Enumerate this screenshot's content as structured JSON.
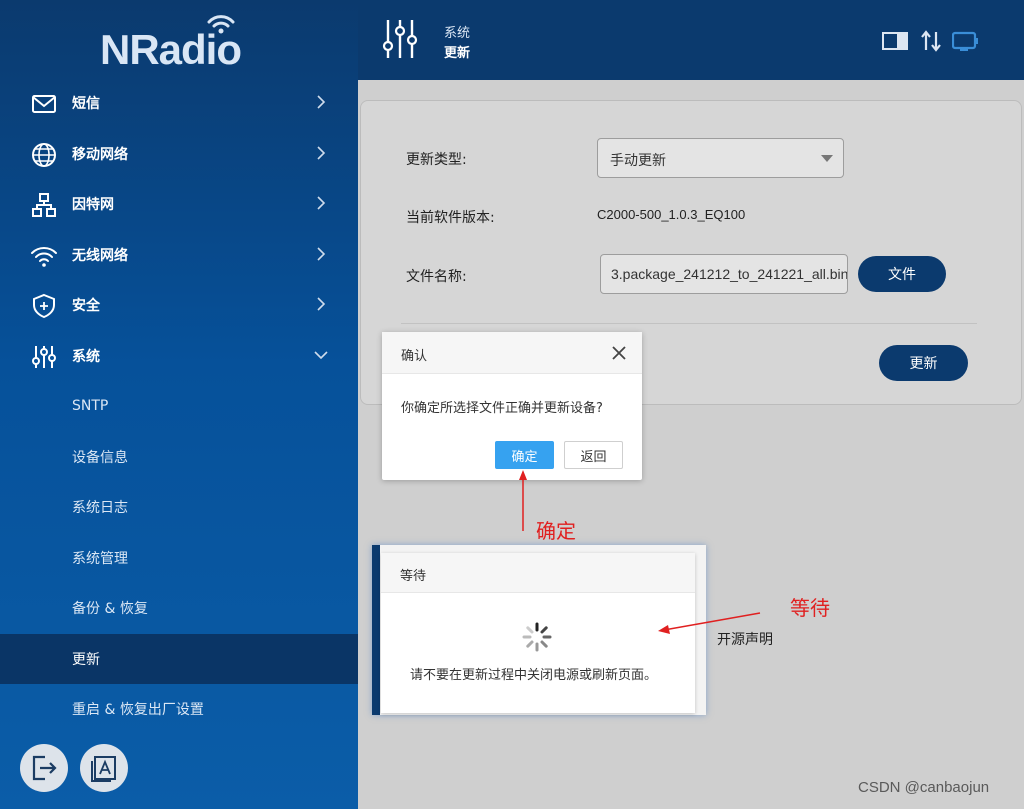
{
  "brand": {
    "logo_text": "NRadio"
  },
  "sidebar": {
    "items": [
      {
        "label": "短信",
        "icon": "mail-icon"
      },
      {
        "label": "移动网络",
        "icon": "globe-icon"
      },
      {
        "label": "因特网",
        "icon": "network-icon"
      },
      {
        "label": "无线网络",
        "icon": "wifi-icon"
      },
      {
        "label": "安全",
        "icon": "shield-icon"
      },
      {
        "label": "系统",
        "icon": "sliders-icon",
        "expanded": true
      }
    ],
    "subitems": [
      {
        "label": "SNTP"
      },
      {
        "label": "设备信息"
      },
      {
        "label": "系统日志"
      },
      {
        "label": "系统管理"
      },
      {
        "label": "备份 & 恢复"
      },
      {
        "label": "更新",
        "active": true
      },
      {
        "label": "重启 & 恢复出厂设置"
      }
    ],
    "footer_buttons": [
      "logout-icon",
      "language-icon"
    ]
  },
  "header": {
    "breadcrumb_parent": "系统",
    "breadcrumb_current": "更新",
    "status_icons": [
      "sim-card-icon",
      "data-transfer-icon",
      "display-icon"
    ]
  },
  "form": {
    "update_type_label": "更新类型:",
    "update_type_value": "手动更新",
    "version_label": "当前软件版本:",
    "version_value": "C2000-500_1.0.3_EQ100",
    "filename_label": "文件名称:",
    "filename_value": "3.package_241212_to_241221_all.bin",
    "file_button": "文件",
    "update_button": "更新"
  },
  "confirm_dialog": {
    "title": "确认",
    "message": "你确定所选择文件正确并更新设备?",
    "ok_label": "确定",
    "back_label": "返回"
  },
  "wait_dialog": {
    "title": "等待",
    "message": "请不要在更新过程中关闭电源或刷新页面。"
  },
  "background_text": {
    "open_source": "开源声明"
  },
  "annotations": {
    "confirm": "确定",
    "wait": "等待",
    "color": "#e02020"
  },
  "watermark": "CSDN @canbaojun",
  "colors": {
    "sidebar": "#06519a",
    "header": "#0b3a6e",
    "accent": "#36a2f0"
  }
}
